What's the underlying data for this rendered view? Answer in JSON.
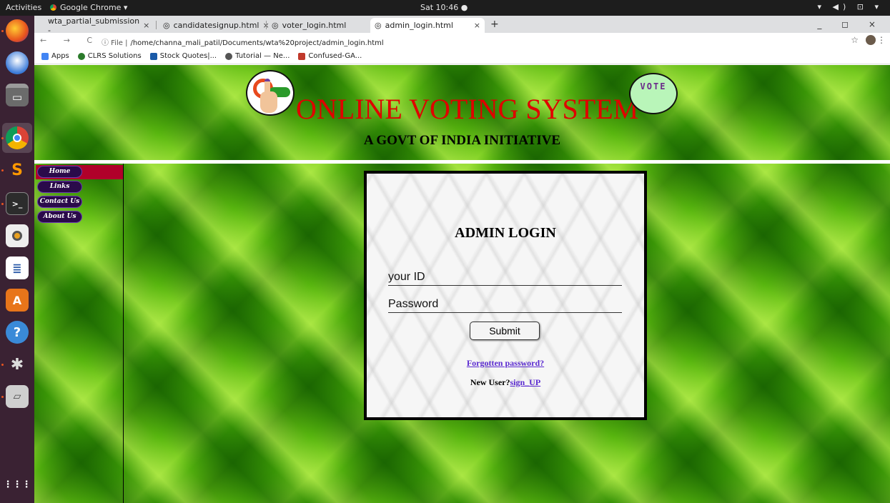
{
  "topbar": {
    "activities": "Activities",
    "app_name": "Google Chrome ▾",
    "clock": "Sat 10:46 ●",
    "tray": "▾ ◀) ⊡ ▾"
  },
  "dock": {
    "icons": [
      "firefox-icon",
      "thunderbird-icon",
      "files-icon",
      "chrome-icon",
      "sublime-icon",
      "terminal-icon",
      "rhythmbox-icon",
      "writer-icon",
      "software-center-icon",
      "help-icon",
      "settings-icon",
      "scanner-icon",
      "app-grid-icon"
    ],
    "app_grid_label": "⋮⋮⋮"
  },
  "browser": {
    "tabs": [
      {
        "label": "wta_partial_submission -",
        "close": "×"
      },
      {
        "label": "candidatesignup.html",
        "close": "×"
      },
      {
        "label": "voter_login.html",
        "close": "×"
      },
      {
        "label": "admin_login.html",
        "close": "×"
      }
    ],
    "new_tab": "+",
    "window_controls": "_ ◻ ×",
    "nav_buttons": "← → C",
    "url_info": "ⓘ File |",
    "url": "/home/channa_mali_patil/Documents/wta%20project/admin_login.html",
    "star": "☆",
    "menu": "⋮",
    "bookmarks": [
      {
        "label": "Apps",
        "color": "#4285f4"
      },
      {
        "label": "CLRS Solutions",
        "color": "#2a7a2a"
      },
      {
        "label": "Stock Quotes|...",
        "color": "#1a5aa8"
      },
      {
        "label": "Tutorial — Ne...",
        "color": "#555555"
      },
      {
        "label": "Confused-GA...",
        "color": "#c0392b"
      }
    ]
  },
  "page": {
    "title": "ONLINE VOTING SYSTEM",
    "subtitle": "A GOVT OF INDIA INITIATIVE",
    "vote_logo_text": "VOTE",
    "nav": [
      "Home",
      "Links",
      "Contact Us",
      "About Us"
    ],
    "login": {
      "heading": "ADMIN LOGIN",
      "id_placeholder": "your ID",
      "password_placeholder": "Password",
      "submit_label": "Submit",
      "forgot_label": "Forgotten password?",
      "new_user_label": "New User?",
      "signup_label": "sign_UP"
    },
    "colors": {
      "title": "#e00000",
      "link": "#5a2ad0",
      "nav_active": "#b0002a"
    }
  }
}
